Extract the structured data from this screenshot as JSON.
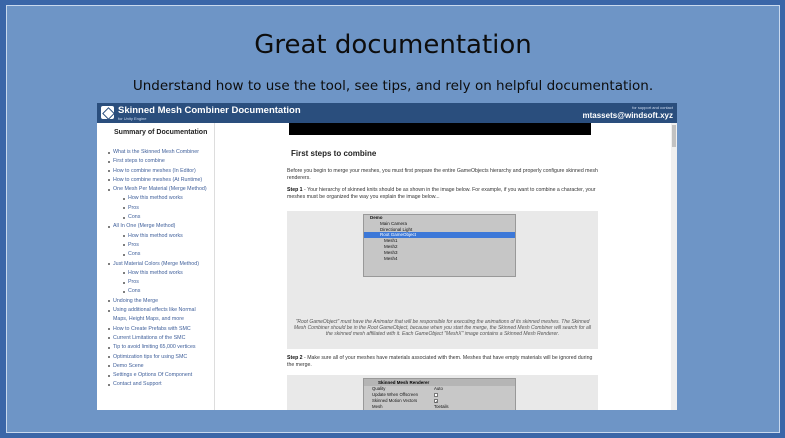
{
  "headline": "Great documentation",
  "tagline": "Understand how to use the tool, see tips, and rely on helpful documentation.",
  "doc": {
    "title": "Skinned Mesh Combiner Documentation",
    "subtitle": "for Unity Engine",
    "support_label": "for support and contact",
    "support_email": "mtassets@windsoft.xyz"
  },
  "sidebar": {
    "title": "Summary of Documentation",
    "items": [
      {
        "label": "What is the Skinned Mesh Combiner",
        "level": 1
      },
      {
        "label": "First steps to combine",
        "level": 1
      },
      {
        "label": "How to combine meshes (In Editor)",
        "level": 1
      },
      {
        "label": "How to combine meshes (At Runtime)",
        "level": 1
      },
      {
        "label": "One Mesh Per Material (Merge Method)",
        "level": 1
      },
      {
        "label": "How this method works",
        "level": 2
      },
      {
        "label": "Pros",
        "level": 2
      },
      {
        "label": "Cons",
        "level": 2
      },
      {
        "label": "All In One (Merge Method)",
        "level": 1
      },
      {
        "label": "How this method works",
        "level": 2
      },
      {
        "label": "Pros",
        "level": 2
      },
      {
        "label": "Cons",
        "level": 2
      },
      {
        "label": "Just Material Colors (Merge Method)",
        "level": 1
      },
      {
        "label": "How this method works",
        "level": 2
      },
      {
        "label": "Pros",
        "level": 2
      },
      {
        "label": "Cons",
        "level": 2
      },
      {
        "label": "Undoing the Merge",
        "level": 1
      },
      {
        "label": "Using additional effects like Normal",
        "level": 1
      },
      {
        "label": "Maps, Height Maps, and more",
        "level": 1.5
      },
      {
        "label": "How to Create Prefabs with SMC",
        "level": 1
      },
      {
        "label": "Current Limitations of the SMC",
        "level": 1
      },
      {
        "label": "Tip to avoid limiting 65,000 vertices",
        "level": 1
      },
      {
        "label": "Optimization tips for using SMC",
        "level": 1
      },
      {
        "label": "Demo Scene",
        "level": 1
      },
      {
        "label": "Settings e Options Of Component",
        "level": 1
      },
      {
        "label": "Contact and Support",
        "level": 1
      }
    ]
  },
  "content": {
    "heading": "First steps to combine",
    "intro": "Before you begin to merge your meshes, you must first prepare the entire GameObjects hierarchy and properly configure skinned mesh renderers.",
    "step1_label": "Step 1",
    "step1_text": " - Your hierarchy of skinned knits should be as shown in the image below. For example, if you want to combine a character, your meshes must be organized the way you explain the image below...",
    "hierarchy": {
      "root": "Demo",
      "rows": [
        "Main Camera",
        "Directional Light",
        "Root GameObject",
        "Mesh1",
        "Mesh2",
        "Mesh3",
        "Mesh4"
      ],
      "selected": "Root GameObject"
    },
    "caption": "\"Root GameObject\" must have the Animator that will be responsible for executing the animations of its skinned meshes. The Skinned Mesh Combiner should be in the Root GameObject, because when you start the merge, the Skinned Mesh Combiner will search for all the skinned mesh affiliated with it. Each GameObject \"MeshX\" image contains a Skinned Mesh Renderer.",
    "step2_label": "Step 2",
    "step2_text": " - Make sure all of your meshes have materials associated with them. Meshes that have empty materials will be ignored during the merge.",
    "inspector": {
      "header": "Skinned Mesh Renderer",
      "rows": [
        {
          "label": "Quality",
          "value": "Auto"
        },
        {
          "label": "Update When Offscreen",
          "value": ""
        },
        {
          "label": "Skinned Motion Vectors",
          "value": "✓"
        },
        {
          "label": "Mesh",
          "value": "Toetails"
        }
      ]
    }
  }
}
